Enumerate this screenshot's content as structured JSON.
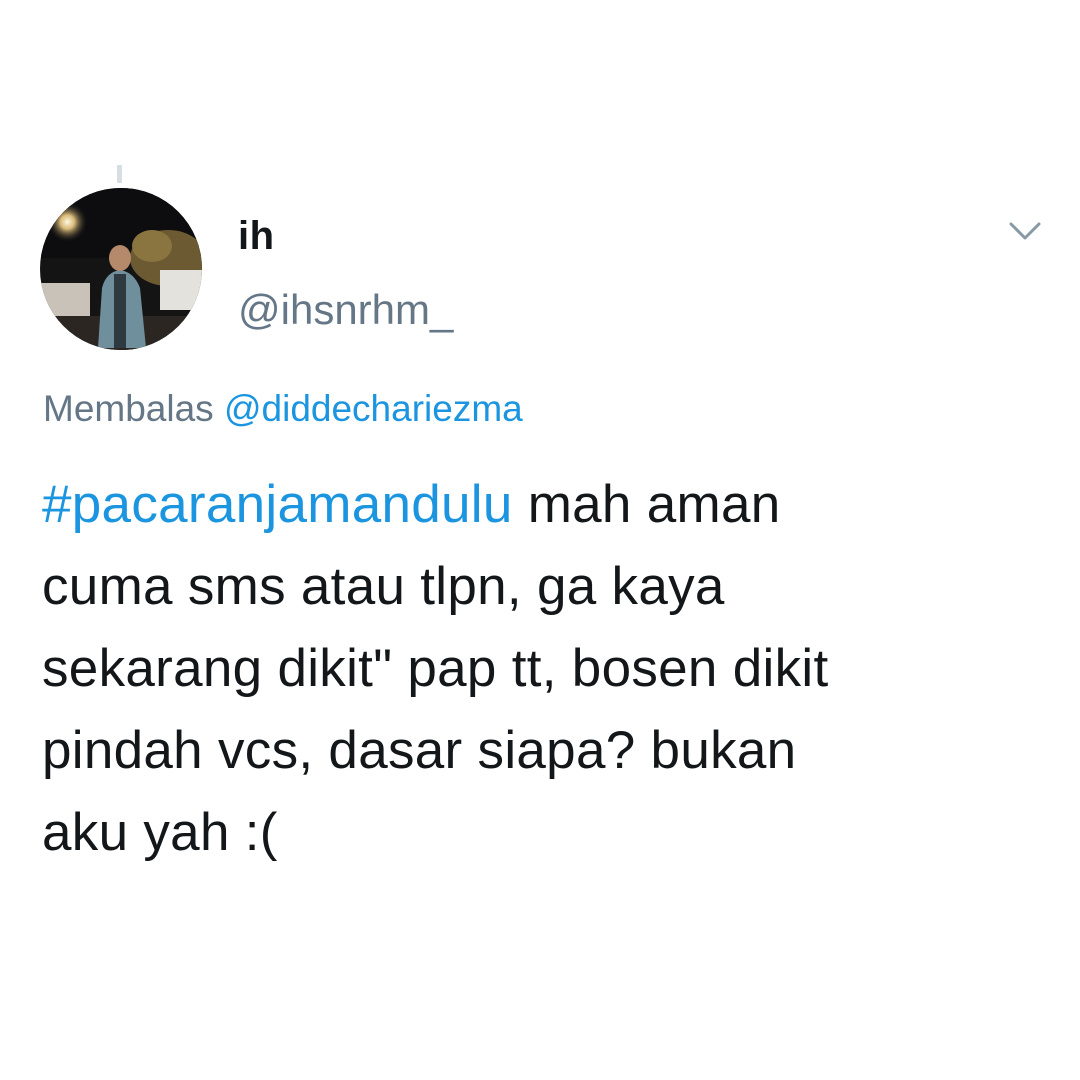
{
  "tweet": {
    "display_name": "ih",
    "handle": "@ihsnrhm_",
    "reply_prefix": "Membalas",
    "reply_to": "@diddechariezma",
    "hashtag": "#pacaranjamandulu",
    "body_lines": [
      " mah aman",
      "cuma sms atau tlpn, ga kaya",
      "sekarang dikit\" pap tt, bosen dikit",
      "pindah vcs, dasar siapa? bukan",
      "aku yah :("
    ]
  },
  "icons": {
    "more": "chevron-down-icon",
    "avatar": "profile-photo"
  },
  "colors": {
    "link": "#1b95e0",
    "secondary_text": "#657786",
    "primary_text": "#14171a",
    "thread_line": "#d6dde3"
  }
}
